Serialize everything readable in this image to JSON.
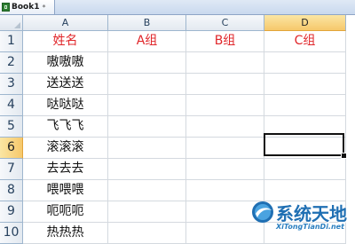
{
  "workbook": {
    "tab_title": "Book1",
    "tab_close": "*"
  },
  "columns": [
    "A",
    "B",
    "C",
    "D"
  ],
  "active_column": "D",
  "rows": [
    "1",
    "2",
    "3",
    "4",
    "5",
    "6",
    "7",
    "8",
    "9",
    "10"
  ],
  "active_row": "6",
  "cells": [
    [
      "姓名",
      "A组",
      "B组",
      "C组"
    ],
    [
      "嗷嗷嗷",
      "",
      "",
      ""
    ],
    [
      "送送送",
      "",
      "",
      ""
    ],
    [
      "哒哒哒",
      "",
      "",
      ""
    ],
    [
      "飞飞飞",
      "",
      "",
      ""
    ],
    [
      "滚滚滚",
      "",
      "",
      ""
    ],
    [
      "去去去",
      "",
      "",
      ""
    ],
    [
      "喂喂喂",
      "",
      "",
      ""
    ],
    [
      "呃呃呃",
      "",
      "",
      ""
    ],
    [
      "热热热",
      "",
      "",
      ""
    ]
  ],
  "selected_cell": "D6",
  "colors": {
    "header_text": "#e0262a",
    "selection": "#111111",
    "active_header": "#f6c86b"
  },
  "watermark": {
    "title": "系统天地",
    "url": "XiTongTianDi.net"
  }
}
